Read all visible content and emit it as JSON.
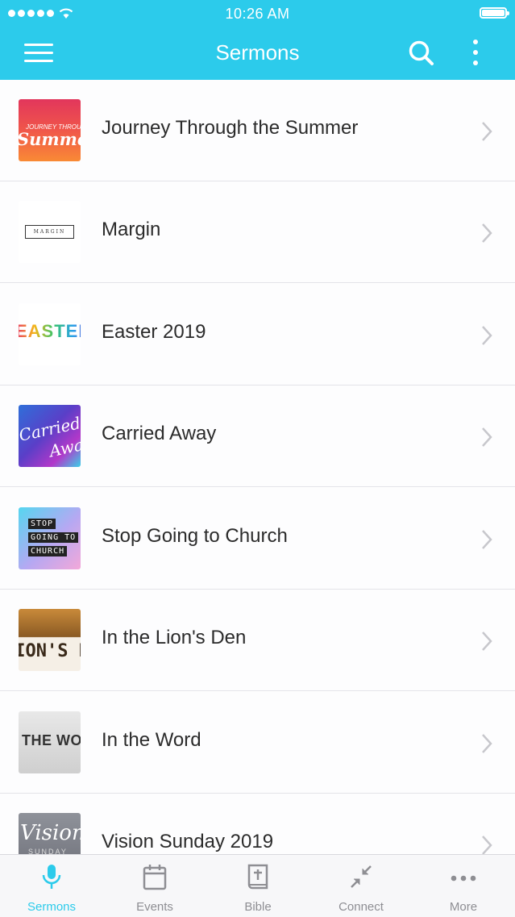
{
  "status_bar": {
    "time": "10:26 AM"
  },
  "header": {
    "title": "Sermons"
  },
  "sermons": [
    {
      "title": "Journey Through the Summer",
      "thumb_text": "JOURNEY THROUGH",
      "thumb_text2": "Summer"
    },
    {
      "title": "Margin",
      "thumb_text": "MARGIN"
    },
    {
      "title": "Easter 2019",
      "thumb_text": "EASTER"
    },
    {
      "title": "Carried Away",
      "thumb_text": "Carried",
      "thumb_text2": "Away"
    },
    {
      "title": "Stop Going to Church",
      "thumb_text": "STOP",
      "thumb_text2": "GOING TO",
      "thumb_text3": "CHURCH"
    },
    {
      "title": "In the Lion's Den",
      "thumb_text": "LION'S DEN"
    },
    {
      "title": "In the Word",
      "thumb_text": "THE WORD"
    },
    {
      "title": "Vision Sunday 2019",
      "thumb_text": "Vision",
      "thumb_text2": "SUNDAY"
    }
  ],
  "tabs": [
    {
      "label": "Sermons",
      "icon": "microphone-icon",
      "active": true
    },
    {
      "label": "Events",
      "icon": "calendar-icon",
      "active": false
    },
    {
      "label": "Bible",
      "icon": "bible-icon",
      "active": false
    },
    {
      "label": "Connect",
      "icon": "connect-arrows-icon",
      "active": false
    },
    {
      "label": "More",
      "icon": "ellipsis-icon",
      "active": false
    }
  ],
  "colors": {
    "accent": "#2ccbeb",
    "inactive": "#8e8e93"
  }
}
